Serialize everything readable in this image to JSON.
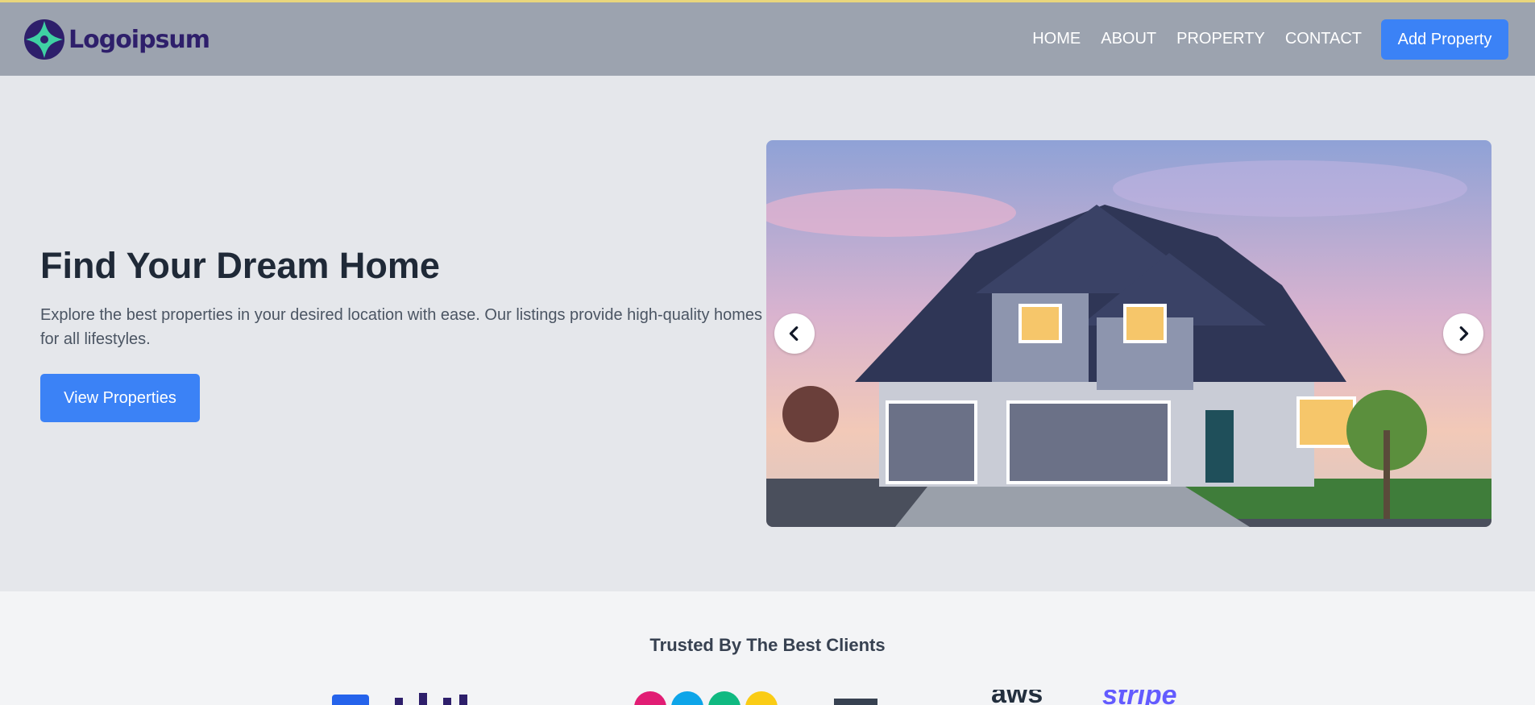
{
  "brand": {
    "name": "Logoipsum"
  },
  "nav": {
    "links": [
      "HOME",
      "ABOUT",
      "PROPERTY",
      "CONTACT"
    ],
    "cta_label": "Add Property"
  },
  "hero": {
    "title": "Find Your Dream Home",
    "description": "Explore the best properties in your desired location with ease. Our listings provide high-quality homes for all lifestyles.",
    "button_label": "View Properties",
    "carousel_prev_icon": "chevron-left-icon",
    "carousel_next_icon": "chevron-right-icon"
  },
  "clients": {
    "title": "Trusted By The Best Clients",
    "logos": [
      "aws",
      "stripe"
    ]
  },
  "colors": {
    "accent": "#3b82f6",
    "navbar": "#9ca3af",
    "hero_bg": "#e5e7eb",
    "top_line": "#e9d67c"
  }
}
